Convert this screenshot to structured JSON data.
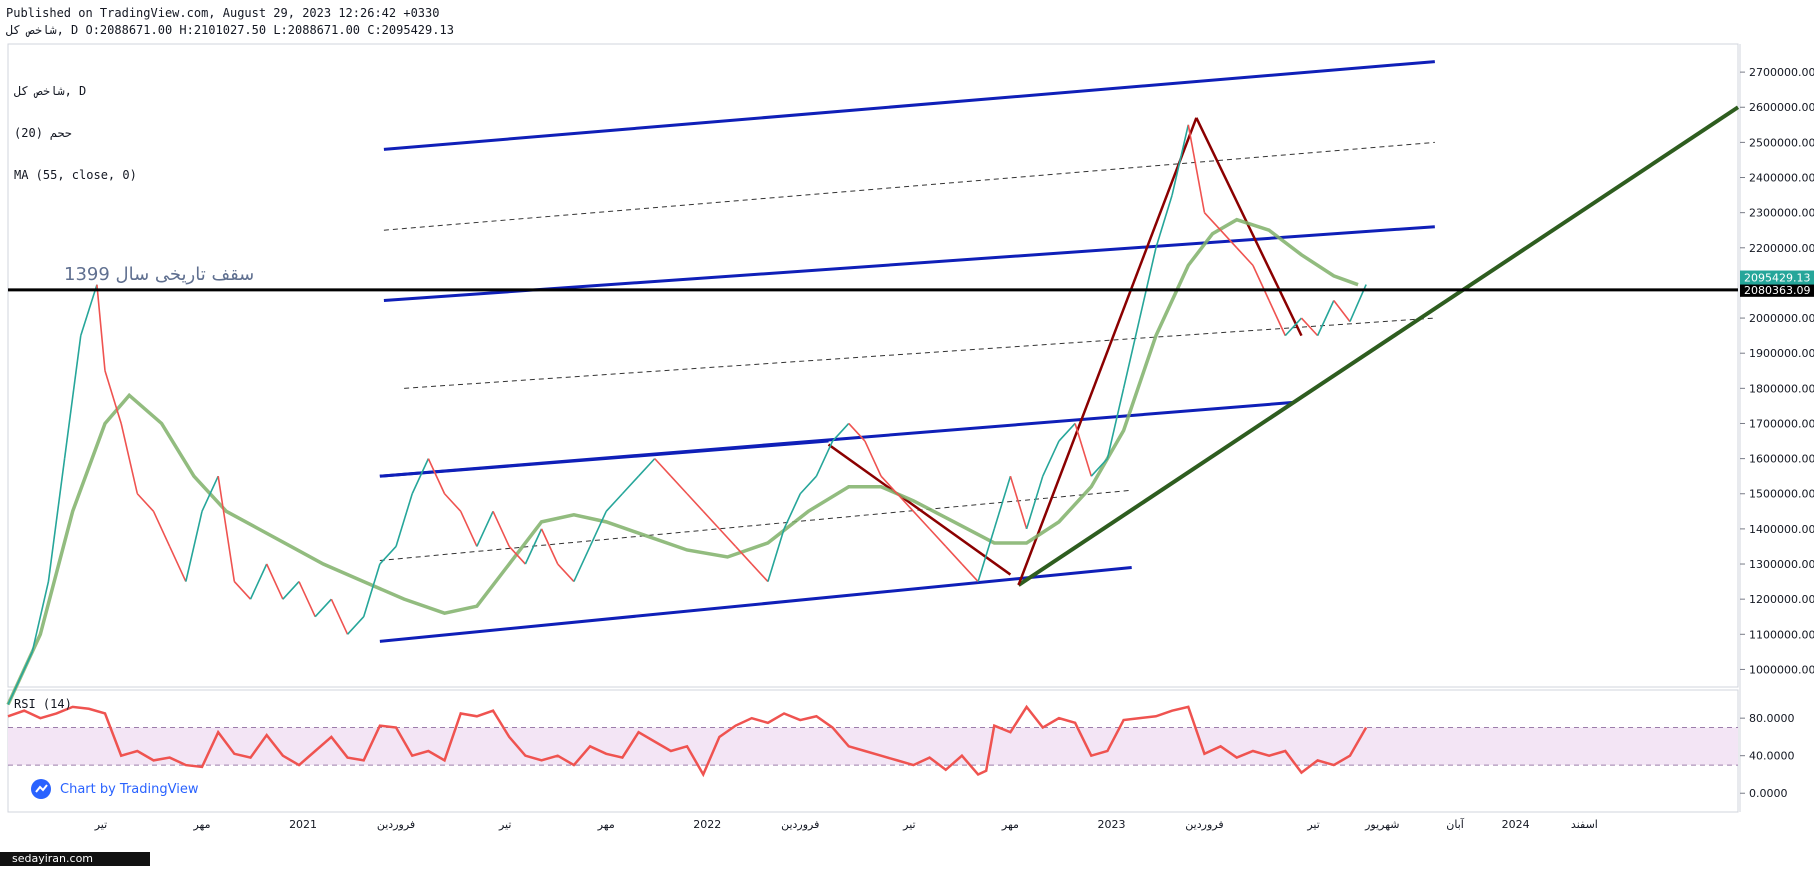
{
  "header": {
    "published": "Published on TradingView.com, August 29, 2023 12:26:42 +0330",
    "ohlc": "شاخص کل, D O:2088671.00 H:2101027.50 L:2088671.00 C:2095429.13"
  },
  "legend": {
    "symbol": "شاخص کل, D",
    "vol": "ححم (20)",
    "ma": "MA (55, close, 0)"
  },
  "annotation": "سقف تاریخی سال 1399",
  "badge": {
    "label": "Chart by TradingView"
  },
  "watermark": "sedayiran.com",
  "colors": {
    "up": "#26a69a",
    "down": "#ef5350",
    "ma": "#7fb069",
    "channel": "#0f1fb8",
    "trend": "#2e5d1f",
    "arrow": "#8b0000",
    "rsi": "#ef5350",
    "rsi_band": "#f3e5f5",
    "last_price": "#26a69a",
    "hline": "#000000"
  },
  "chart_data": [
    {
      "type": "line",
      "name": "main-price",
      "y_ticks": [
        1000000,
        1100000,
        1200000,
        1300000,
        1400000,
        1500000,
        1600000,
        1700000,
        1800000,
        1900000,
        2000000,
        2100000,
        2200000,
        2300000,
        2400000,
        2500000,
        2600000,
        2700000
      ],
      "y_tick_labels": [
        "1000000.00",
        "1100000.00",
        "1200000.00",
        "1300000.00",
        "1400000.00",
        "1500000.00",
        "1600000.00",
        "1700000.00",
        "1800000.00",
        "1900000.00",
        "2000000.00",
        "2100000.00",
        "2200000.00",
        "2300000.00",
        "2400000.00",
        "2500000.00",
        "2600000.00",
        "2700000.00"
      ],
      "ylim": [
        950000,
        2780000
      ],
      "xlim": [
        2020.32,
        2024.6
      ],
      "x_ticks": [
        {
          "x": 2020.55,
          "label": "تیر"
        },
        {
          "x": 2020.8,
          "label": "مهر"
        },
        {
          "x": 2021.05,
          "label": "2021"
        },
        {
          "x": 2021.28,
          "label": "فروردین"
        },
        {
          "x": 2021.55,
          "label": "تیر"
        },
        {
          "x": 2021.8,
          "label": "مهر"
        },
        {
          "x": 2022.05,
          "label": "2022"
        },
        {
          "x": 2022.28,
          "label": "فروردین"
        },
        {
          "x": 2022.55,
          "label": "تیر"
        },
        {
          "x": 2022.8,
          "label": "مهر"
        },
        {
          "x": 2023.05,
          "label": "2023"
        },
        {
          "x": 2023.28,
          "label": "فروردین"
        },
        {
          "x": 2023.55,
          "label": "تیر"
        },
        {
          "x": 2023.72,
          "label": "شهریور"
        },
        {
          "x": 2023.9,
          "label": "آبان"
        },
        {
          "x": 2024.05,
          "label": "2024"
        },
        {
          "x": 2024.22,
          "label": "اسفند"
        }
      ],
      "price_points": [
        [
          2020.32,
          900000
        ],
        [
          2020.38,
          1050000
        ],
        [
          2020.42,
          1250000
        ],
        [
          2020.46,
          1600000
        ],
        [
          2020.5,
          1950000
        ],
        [
          2020.54,
          2095000
        ],
        [
          2020.56,
          1850000
        ],
        [
          2020.6,
          1700000
        ],
        [
          2020.64,
          1500000
        ],
        [
          2020.68,
          1450000
        ],
        [
          2020.72,
          1350000
        ],
        [
          2020.76,
          1250000
        ],
        [
          2020.8,
          1450000
        ],
        [
          2020.84,
          1550000
        ],
        [
          2020.88,
          1250000
        ],
        [
          2020.92,
          1200000
        ],
        [
          2020.96,
          1300000
        ],
        [
          2021.0,
          1200000
        ],
        [
          2021.04,
          1250000
        ],
        [
          2021.08,
          1150000
        ],
        [
          2021.12,
          1200000
        ],
        [
          2021.16,
          1100000
        ],
        [
          2021.2,
          1150000
        ],
        [
          2021.24,
          1300000
        ],
        [
          2021.28,
          1350000
        ],
        [
          2021.32,
          1500000
        ],
        [
          2021.36,
          1600000
        ],
        [
          2021.4,
          1500000
        ],
        [
          2021.44,
          1450000
        ],
        [
          2021.48,
          1350000
        ],
        [
          2021.52,
          1450000
        ],
        [
          2021.56,
          1350000
        ],
        [
          2021.6,
          1300000
        ],
        [
          2021.64,
          1400000
        ],
        [
          2021.68,
          1300000
        ],
        [
          2021.72,
          1250000
        ],
        [
          2021.76,
          1350000
        ],
        [
          2021.8,
          1450000
        ],
        [
          2021.84,
          1500000
        ],
        [
          2021.88,
          1550000
        ],
        [
          2021.92,
          1600000
        ],
        [
          2021.96,
          1550000
        ],
        [
          2022.0,
          1500000
        ],
        [
          2022.04,
          1450000
        ],
        [
          2022.08,
          1400000
        ],
        [
          2022.12,
          1350000
        ],
        [
          2022.16,
          1300000
        ],
        [
          2022.2,
          1250000
        ],
        [
          2022.24,
          1400000
        ],
        [
          2022.28,
          1500000
        ],
        [
          2022.32,
          1550000
        ],
        [
          2022.36,
          1650000
        ],
        [
          2022.4,
          1700000
        ],
        [
          2022.44,
          1650000
        ],
        [
          2022.48,
          1550000
        ],
        [
          2022.52,
          1500000
        ],
        [
          2022.56,
          1450000
        ],
        [
          2022.6,
          1400000
        ],
        [
          2022.64,
          1350000
        ],
        [
          2022.68,
          1300000
        ],
        [
          2022.72,
          1250000
        ],
        [
          2022.76,
          1400000
        ],
        [
          2022.8,
          1550000
        ],
        [
          2022.84,
          1400000
        ],
        [
          2022.88,
          1550000
        ],
        [
          2022.92,
          1650000
        ],
        [
          2022.96,
          1700000
        ],
        [
          2023.0,
          1550000
        ],
        [
          2023.04,
          1600000
        ],
        [
          2023.08,
          1800000
        ],
        [
          2023.12,
          2000000
        ],
        [
          2023.16,
          2200000
        ],
        [
          2023.2,
          2350000
        ],
        [
          2023.24,
          2550000
        ],
        [
          2023.28,
          2300000
        ],
        [
          2023.32,
          2250000
        ],
        [
          2023.36,
          2200000
        ],
        [
          2023.4,
          2150000
        ],
        [
          2023.44,
          2050000
        ],
        [
          2023.48,
          1950000
        ],
        [
          2023.52,
          2000000
        ],
        [
          2023.56,
          1950000
        ],
        [
          2023.6,
          2050000
        ],
        [
          2023.64,
          1990000
        ],
        [
          2023.68,
          2095429
        ]
      ],
      "ma_points": [
        [
          2020.32,
          900000
        ],
        [
          2020.4,
          1100000
        ],
        [
          2020.48,
          1450000
        ],
        [
          2020.56,
          1700000
        ],
        [
          2020.62,
          1780000
        ],
        [
          2020.7,
          1700000
        ],
        [
          2020.78,
          1550000
        ],
        [
          2020.86,
          1450000
        ],
        [
          2020.94,
          1400000
        ],
        [
          2021.02,
          1350000
        ],
        [
          2021.1,
          1300000
        ],
        [
          2021.2,
          1250000
        ],
        [
          2021.3,
          1200000
        ],
        [
          2021.4,
          1160000
        ],
        [
          2021.48,
          1180000
        ],
        [
          2021.56,
          1300000
        ],
        [
          2021.64,
          1420000
        ],
        [
          2021.72,
          1440000
        ],
        [
          2021.8,
          1420000
        ],
        [
          2021.9,
          1380000
        ],
        [
          2022.0,
          1340000
        ],
        [
          2022.1,
          1320000
        ],
        [
          2022.2,
          1360000
        ],
        [
          2022.3,
          1450000
        ],
        [
          2022.4,
          1520000
        ],
        [
          2022.48,
          1520000
        ],
        [
          2022.56,
          1480000
        ],
        [
          2022.66,
          1420000
        ],
        [
          2022.76,
          1360000
        ],
        [
          2022.84,
          1360000
        ],
        [
          2022.92,
          1420000
        ],
        [
          2023.0,
          1520000
        ],
        [
          2023.08,
          1680000
        ],
        [
          2023.16,
          1950000
        ],
        [
          2023.24,
          2150000
        ],
        [
          2023.3,
          2240000
        ],
        [
          2023.36,
          2280000
        ],
        [
          2023.44,
          2250000
        ],
        [
          2023.52,
          2180000
        ],
        [
          2023.6,
          2120000
        ],
        [
          2023.66,
          2095000
        ]
      ],
      "last_price": {
        "value": 2095429.13,
        "label": "2095429.13"
      },
      "hline": {
        "value": 2080363.09,
        "label": "2080363.09"
      }
    },
    {
      "type": "line",
      "name": "RSI (14)",
      "y_ticks": [
        0,
        40,
        80
      ],
      "y_tick_labels": [
        "0.0000",
        "40.0000",
        "80.0000"
      ],
      "ylim": [
        -20,
        110
      ],
      "band": [
        30,
        70
      ],
      "points": [
        [
          2020.32,
          82
        ],
        [
          2020.36,
          88
        ],
        [
          2020.4,
          80
        ],
        [
          2020.44,
          85
        ],
        [
          2020.48,
          92
        ],
        [
          2020.52,
          90
        ],
        [
          2020.56,
          85
        ],
        [
          2020.6,
          40
        ],
        [
          2020.64,
          45
        ],
        [
          2020.68,
          35
        ],
        [
          2020.72,
          38
        ],
        [
          2020.76,
          30
        ],
        [
          2020.8,
          28
        ],
        [
          2020.84,
          65
        ],
        [
          2020.88,
          42
        ],
        [
          2020.92,
          38
        ],
        [
          2020.96,
          62
        ],
        [
          2021.0,
          40
        ],
        [
          2021.04,
          30
        ],
        [
          2021.08,
          45
        ],
        [
          2021.12,
          60
        ],
        [
          2021.16,
          38
        ],
        [
          2021.2,
          35
        ],
        [
          2021.24,
          72
        ],
        [
          2021.28,
          70
        ],
        [
          2021.32,
          40
        ],
        [
          2021.36,
          45
        ],
        [
          2021.4,
          35
        ],
        [
          2021.44,
          85
        ],
        [
          2021.48,
          82
        ],
        [
          2021.52,
          88
        ],
        [
          2021.56,
          60
        ],
        [
          2021.6,
          40
        ],
        [
          2021.64,
          35
        ],
        [
          2021.68,
          40
        ],
        [
          2021.72,
          30
        ],
        [
          2021.76,
          50
        ],
        [
          2021.8,
          42
        ],
        [
          2021.84,
          38
        ],
        [
          2021.88,
          65
        ],
        [
          2021.92,
          55
        ],
        [
          2021.96,
          45
        ],
        [
          2022.0,
          50
        ],
        [
          2022.04,
          20
        ],
        [
          2022.08,
          60
        ],
        [
          2022.12,
          72
        ],
        [
          2022.16,
          80
        ],
        [
          2022.2,
          75
        ],
        [
          2022.24,
          85
        ],
        [
          2022.28,
          78
        ],
        [
          2022.32,
          82
        ],
        [
          2022.36,
          70
        ],
        [
          2022.4,
          50
        ],
        [
          2022.44,
          45
        ],
        [
          2022.48,
          40
        ],
        [
          2022.52,
          35
        ],
        [
          2022.56,
          30
        ],
        [
          2022.6,
          38
        ],
        [
          2022.64,
          25
        ],
        [
          2022.68,
          40
        ],
        [
          2022.72,
          20
        ],
        [
          2022.74,
          24
        ],
        [
          2022.76,
          72
        ],
        [
          2022.8,
          65
        ],
        [
          2022.84,
          92
        ],
        [
          2022.88,
          70
        ],
        [
          2022.92,
          80
        ],
        [
          2022.96,
          75
        ],
        [
          2023.0,
          40
        ],
        [
          2023.04,
          45
        ],
        [
          2023.08,
          78
        ],
        [
          2023.12,
          80
        ],
        [
          2023.16,
          82
        ],
        [
          2023.2,
          88
        ],
        [
          2023.24,
          92
        ],
        [
          2023.28,
          42
        ],
        [
          2023.32,
          50
        ],
        [
          2023.36,
          38
        ],
        [
          2023.4,
          45
        ],
        [
          2023.44,
          40
        ],
        [
          2023.48,
          45
        ],
        [
          2023.52,
          22
        ],
        [
          2023.56,
          35
        ],
        [
          2023.6,
          30
        ],
        [
          2023.64,
          40
        ],
        [
          2023.68,
          70
        ]
      ]
    }
  ]
}
